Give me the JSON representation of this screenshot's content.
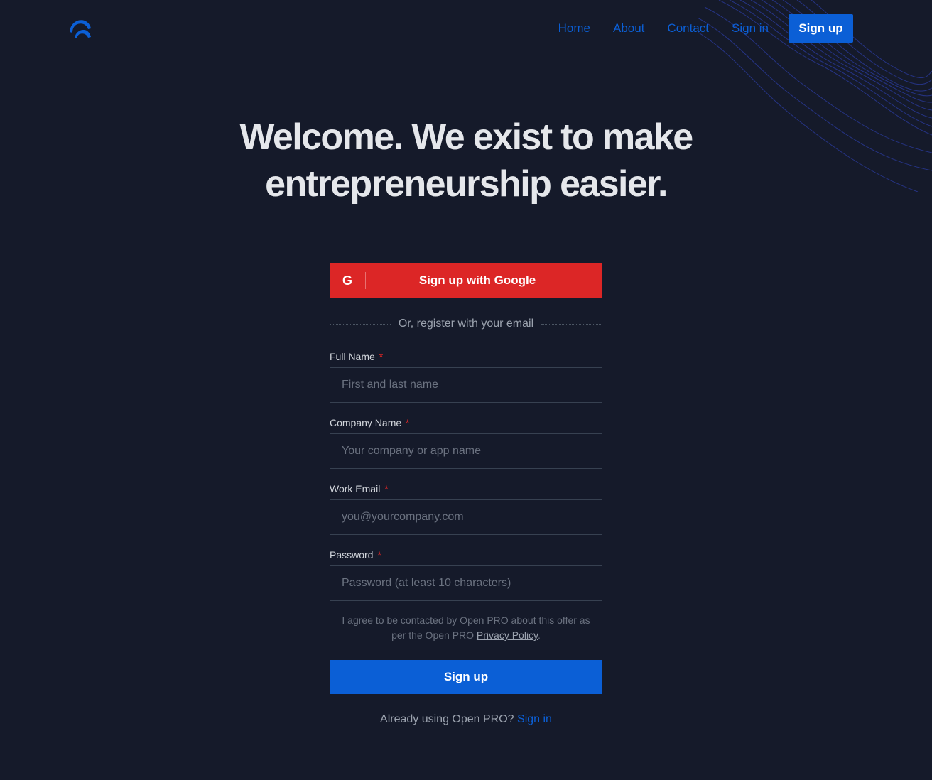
{
  "colors": {
    "background": "#151a2a",
    "primary": "#0b5fd6",
    "google_red": "#dc2626",
    "heading": "#e5e7eb",
    "muted": "#9ca3af"
  },
  "header": {
    "logo_icon": "open-pro-logo-icon",
    "nav": {
      "home": "Home",
      "about": "About",
      "contact": "Contact",
      "sign_in": "Sign in",
      "sign_up": "Sign up"
    }
  },
  "hero": {
    "line1": "Welcome. We exist to make",
    "line2": "entrepreneurship easier."
  },
  "form": {
    "google_icon": "G",
    "google_button": "Sign up with Google",
    "divider_text": "Or, register with your email",
    "required_marker": "*",
    "fields": [
      {
        "label": "Full Name",
        "placeholder": "First and last name"
      },
      {
        "label": "Company Name",
        "placeholder": "Your company or app name"
      },
      {
        "label": "Work Email",
        "placeholder": "you@yourcompany.com"
      },
      {
        "label": "Password",
        "placeholder": "Password (at least 10 characters)"
      }
    ],
    "consent_text": "I agree to be contacted by Open PRO about this offer as per the Open PRO ",
    "privacy_link": "Privacy Policy",
    "consent_end": ".",
    "submit": "Sign up",
    "already_text": "Already using Open PRO?",
    "sign_in_link": "Sign in"
  }
}
